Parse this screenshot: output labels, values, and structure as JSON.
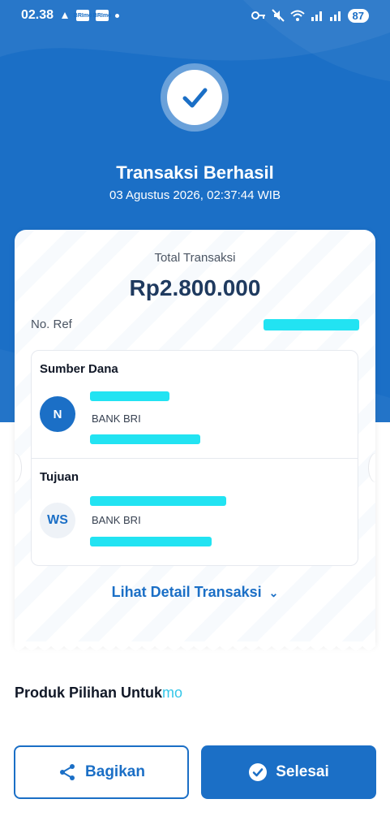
{
  "status_bar": {
    "time": "02.38",
    "mini_icon_label": "BRImo",
    "battery": "87"
  },
  "header": {
    "title": "Transaksi Berhasil",
    "datetime": "03 Agustus 2026, 02:37:44 WIB",
    "status_icon": "check-circle-icon"
  },
  "summary": {
    "total_label": "Total Transaksi",
    "total_amount": "Rp2.800.000",
    "ref_label": "No. Ref"
  },
  "source": {
    "title": "Sumber Dana",
    "initials": "N",
    "bank": "BANK BRI"
  },
  "destination": {
    "title": "Tujuan",
    "initials": "WS",
    "bank": "BANK BRI"
  },
  "detail_link": {
    "label": "Lihat Detail Transaksi",
    "icon": "chevron-down-icon"
  },
  "products": {
    "label": "Produk Pilihan Untuk",
    "brand": "mo"
  },
  "actions": {
    "share_label": "Bagikan",
    "share_icon": "share-icon",
    "done_label": "Selesai",
    "done_icon": "check-circle-icon"
  },
  "colors": {
    "primary": "#1b6fc6",
    "redaction": "#22e3f2",
    "brand_accent": "#35c6e8"
  }
}
